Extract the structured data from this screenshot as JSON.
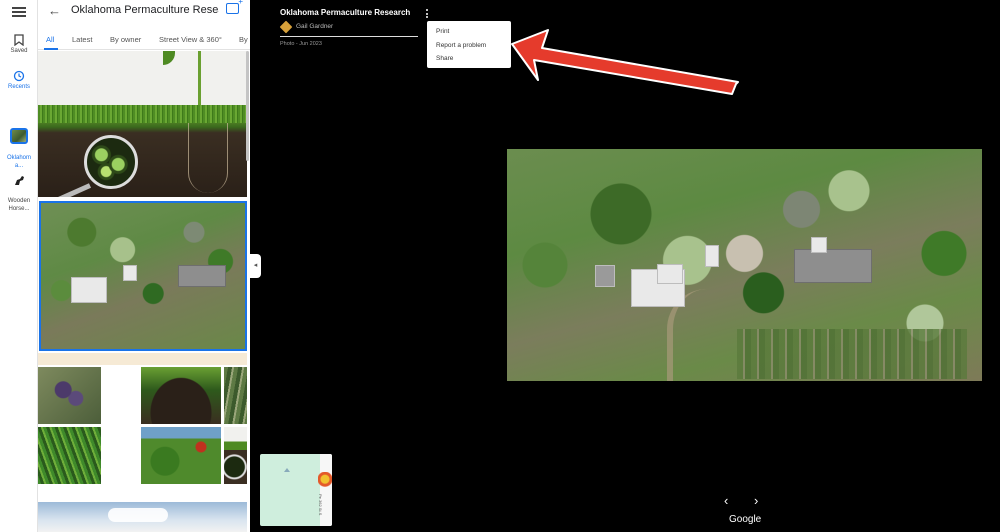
{
  "rail": {
    "saved_label": "Saved",
    "recents_label": "Recents",
    "recent_place_1": "Oklahom\na...",
    "recent_place_2": "Wooden\nHorse..."
  },
  "panel": {
    "title": "Oklahoma Permaculture Resea",
    "tabs": [
      "All",
      "Latest",
      "By owner",
      "Street View & 360°",
      "By"
    ]
  },
  "viewer": {
    "place_title": "Oklahoma Permaculture Research I...",
    "author": "Gail Gardner",
    "date": "Photo - Jun 2023",
    "menu": [
      "Print",
      "Report a problem",
      "Share"
    ],
    "minimap_road": "Pe 362 St S",
    "google_label": "Google",
    "prev_icon": "‹",
    "next_icon": "›"
  },
  "colors": {
    "accent": "#1a73e8",
    "annotation_arrow": "#e53b2c"
  }
}
